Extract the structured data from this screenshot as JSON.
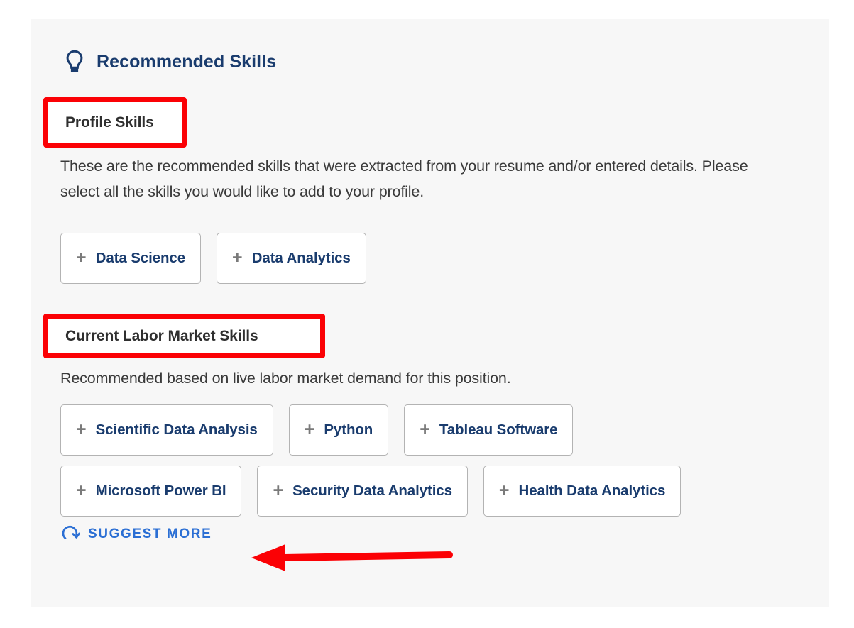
{
  "card": {
    "header": {
      "icon": "lightbulb-icon",
      "title": "Recommended Skills"
    },
    "sections": [
      {
        "id": "profile",
        "heading": "Profile Skills",
        "description": "These are the recommended skills that were extracted from your resume and/or entered details. Please select all the skills you would like to add to your profile.",
        "chips": [
          {
            "plus": "+",
            "label": "Data Science"
          },
          {
            "plus": "+",
            "label": "Data Analytics"
          }
        ]
      },
      {
        "id": "labor",
        "heading": "Current Labor Market Skills",
        "description": "Recommended based on live labor market demand for this position.",
        "chips_row1": [
          {
            "plus": "+",
            "label": "Scientific Data Analysis"
          },
          {
            "plus": "+",
            "label": "Python"
          },
          {
            "plus": "+",
            "label": "Tableau Software"
          }
        ],
        "chips_row2": [
          {
            "plus": "+",
            "label": "Microsoft Power BI"
          },
          {
            "plus": "+",
            "label": "Security Data Analytics"
          },
          {
            "plus": "+",
            "label": "Health Data Analytics"
          }
        ],
        "suggest_more": {
          "icon": "refresh-icon",
          "label": "SUGGEST MORE"
        }
      }
    ]
  },
  "annotations": {
    "highlight_color": "#fb0105",
    "arrow": "left-pointing-arrow",
    "highlighted_headings": [
      "Profile Skills",
      "Current Labor Market Skills"
    ],
    "arrow_target": "SUGGEST MORE"
  },
  "colors": {
    "page_background": "#ffffff",
    "card_background": "#f7f7f7",
    "title_blue": "#1a3c6e",
    "link_blue": "#2b6fd4",
    "body_text": "#3a3a3a",
    "heading_text": "#2f2f2f",
    "chip_border": "#b3b3b3",
    "chip_plus": "#7a7a7a",
    "annotation_red": "#fb0105"
  }
}
